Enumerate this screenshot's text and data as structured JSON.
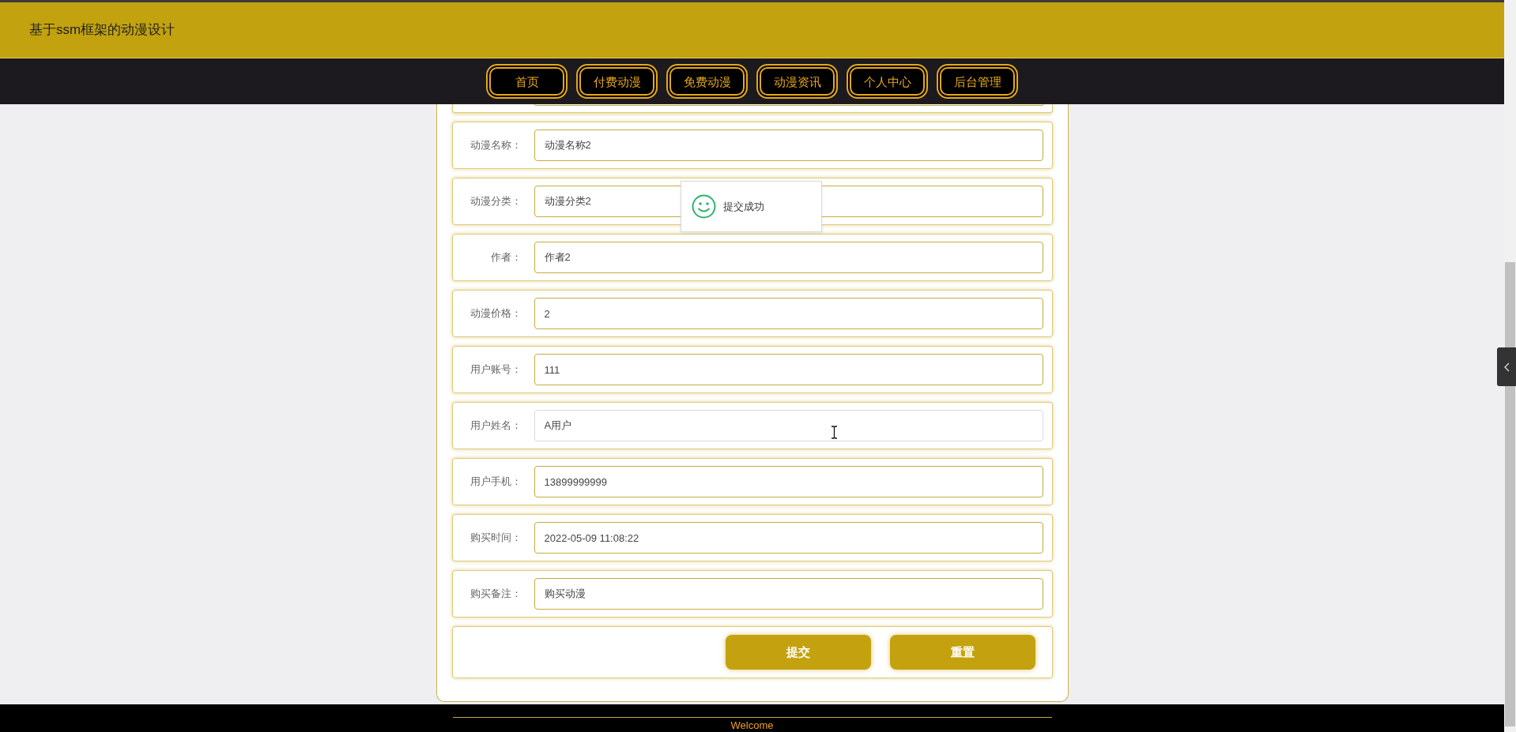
{
  "header": {
    "title": "基于ssm框架的动漫设计"
  },
  "nav": [
    {
      "label": "首页"
    },
    {
      "label": "付费动漫"
    },
    {
      "label": "免费动漫"
    },
    {
      "label": "动漫资讯"
    },
    {
      "label": "个人中心"
    },
    {
      "label": "后台管理"
    }
  ],
  "form": {
    "fields": [
      {
        "label": "动漫名称：",
        "value": "动漫名称2",
        "hovered": false
      },
      {
        "label": "动漫分类：",
        "value": "动漫分类2",
        "hovered": false
      },
      {
        "label": "作者：",
        "value": "作者2",
        "hovered": false
      },
      {
        "label": "动漫价格：",
        "value": "2",
        "hovered": false
      },
      {
        "label": "用户账号：",
        "value": "111",
        "hovered": false
      },
      {
        "label": "用户姓名：",
        "value": "A用户",
        "hovered": true
      },
      {
        "label": "用户手机：",
        "value": "13899999999",
        "hovered": false
      },
      {
        "label": "购买时间：",
        "value": "2022-05-09 11:08:22",
        "hovered": false
      },
      {
        "label": "购买备注：",
        "value": "购买动漫",
        "hovered": false
      }
    ],
    "buttons": [
      {
        "label": "提交"
      },
      {
        "label": "重置"
      }
    ]
  },
  "toast": {
    "message": "提交成功"
  },
  "footer": {
    "text": "Welcome"
  }
}
